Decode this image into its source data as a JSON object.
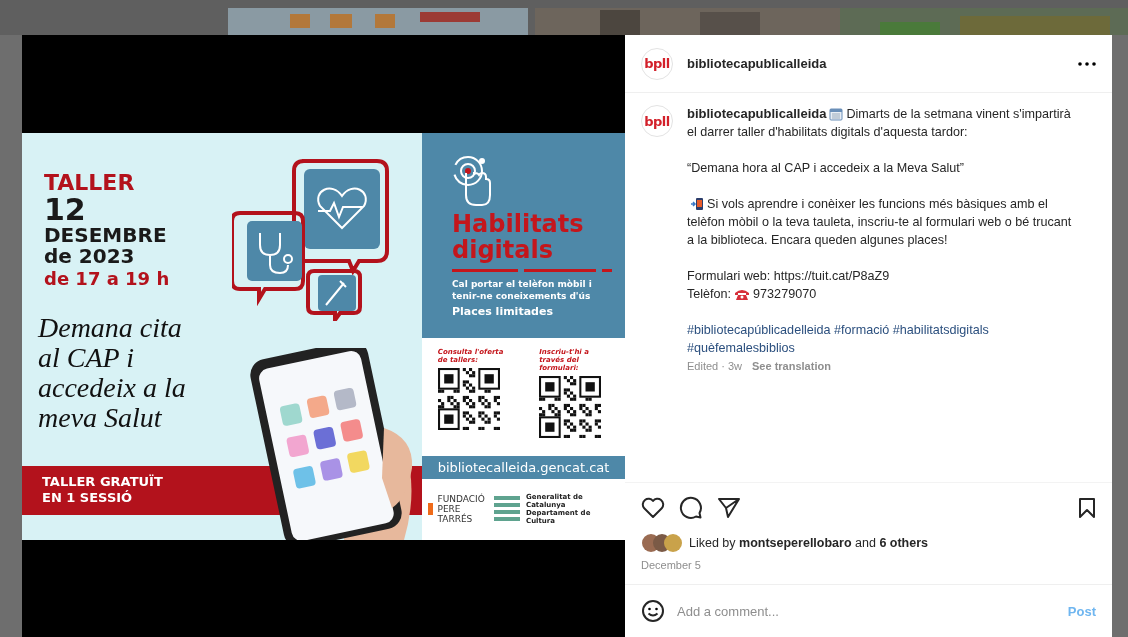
{
  "post": {
    "media": {
      "poster": {
        "title": "TALLER",
        "day": "12",
        "month": "DESEMBRE",
        "year": "de 2023",
        "time": "de 17 a 19 h",
        "headline": "Demana cita al CAP i accedeix a la meva Salut",
        "banner": "TALLER GRATUÏT EN 1 SESSIÓ",
        "program": "Habilitats digitals",
        "requirement": "Cal portar el telèfon mòbil i tenir-ne coneixements d'ús",
        "places": "Places limitades",
        "qr_codes": [
          {
            "caption": "Consulta l'oferta de tallers:"
          },
          {
            "caption": "Inscriu-t'hi a través del formulari:"
          }
        ],
        "website": "bibliotecalleida.gencat.cat",
        "sponsors": [
          "FUNDACIÓ PERE TARRÉS",
          "Generalitat de Catalunya Departament de Cultura"
        ]
      }
    },
    "header": {
      "avatar": "bpll",
      "username": "bibliotecapublicalleida"
    },
    "caption": {
      "avatar": "bpll",
      "username": "bibliotecapublicalleida",
      "intro": "Dimarts de la setmana vinent s'impartirà el darrer taller d'habilitats digitals d'aquesta tardor:",
      "quote": "“Demana hora al CAP i accedeix a la Meva Salut”",
      "tip": "Si vols aprendre i conèixer les funcions més bàsiques amb el telèfon mòbil o la teva tauleta, inscriu-te al formulari web o bé trucant a la biblioteca. Encara queden algunes places!",
      "form_line": "Formulari web: https://tuit.cat/P8aZ9",
      "phone_label": "Telèfon:",
      "phone_number": "973279070",
      "hashtags": [
        "#bibliotecapúblicadelleida",
        "#formació",
        "#habilitatsdigitals",
        "#quèfemalesbiblios"
      ],
      "edited": "Edited · 3w",
      "translate": "See translation"
    },
    "likes": "Liked by **montseperellobaro** and **6 others**",
    "date": "December 5",
    "comment": {
      "placeholder": "Add a comment...",
      "post_button": {
        "label": "Post",
        "disabled": true
      }
    }
  }
}
